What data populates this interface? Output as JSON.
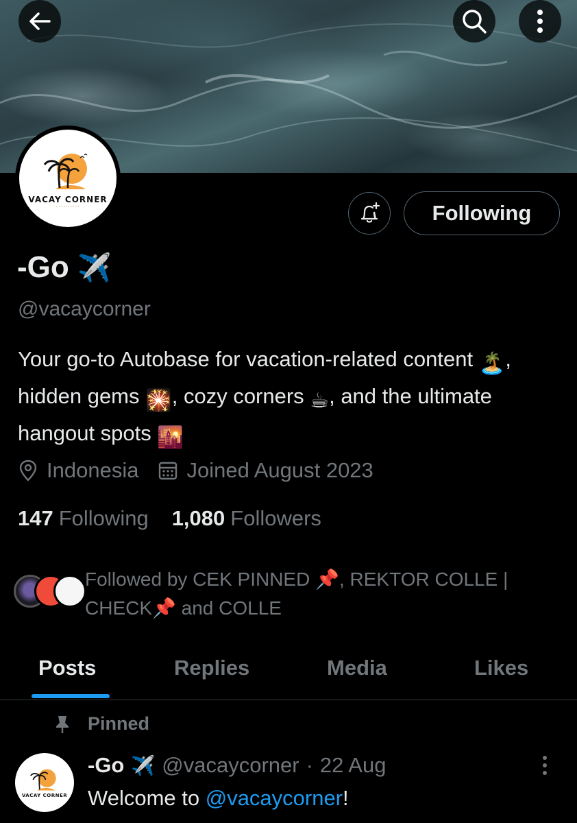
{
  "header": {
    "back_icon": "arrow-left-icon",
    "search_icon": "search-icon",
    "more_icon": "more-vertical-icon"
  },
  "profile": {
    "avatar_logo_text": "VACAY CORNER",
    "display_name": "-Go",
    "name_emoji": "✈️",
    "handle": "@vacaycorner",
    "bio_parts": {
      "p1": "Your go-to Autobase for vacation-related content ",
      "e1": "🏝️",
      "p2": ", hidden gems ",
      "e2": "🎇",
      "p3": ", cozy corners ",
      "e3": "☕",
      "p4": ", and the ultimate hangout spots ",
      "e4": "🌇"
    },
    "location": "Indonesia",
    "joined": "Joined August 2023",
    "following_count": "147",
    "following_label": "Following",
    "followers_count": "1,080",
    "followers_label": "Followers",
    "followed_by_text": "Followed by CEK PINNED 📌, REKTOR COLLE | CHECK📌 and COLLE"
  },
  "actions": {
    "notify_icon": "bell-plus-icon",
    "following_button": "Following"
  },
  "tabs": [
    {
      "label": "Posts",
      "active": true
    },
    {
      "label": "Replies",
      "active": false
    },
    {
      "label": "Media",
      "active": false
    },
    {
      "label": "Likes",
      "active": false
    }
  ],
  "pinned_post": {
    "pinned_label": "Pinned",
    "author_name": "-Go",
    "author_emoji": "✈️",
    "author_handle": "@vacaycorner",
    "separator": "·",
    "date": "22 Aug",
    "text_prefix": "Welcome to ",
    "text_link": "@vacaycorner",
    "text_suffix": "!"
  },
  "colors": {
    "accent": "#1d9bf0",
    "background": "#000000",
    "muted_text": "#71767b",
    "primary_text": "#e7e9ea"
  }
}
